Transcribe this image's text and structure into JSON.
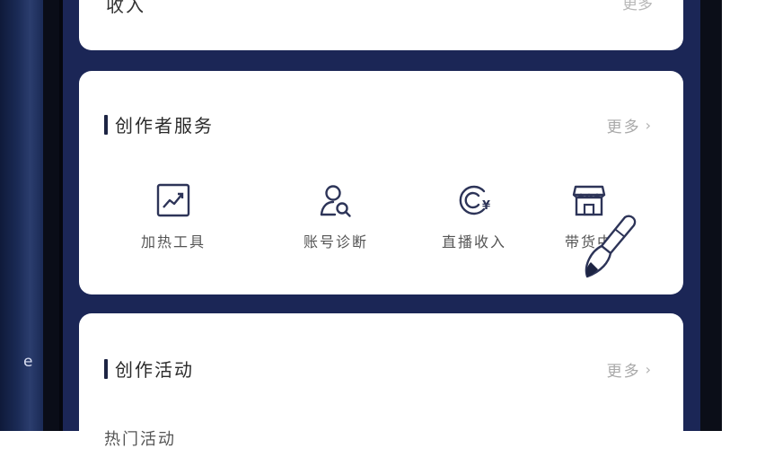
{
  "left_edge": {
    "char": "e"
  },
  "top_card": {
    "title_partial": "收入",
    "more_partial": "更多"
  },
  "creator_services": {
    "title": "创作者服务",
    "more_label": "更多",
    "items": [
      {
        "label": "加热工具",
        "icon": "trending-chart-icon"
      },
      {
        "label": "账号诊断",
        "icon": "user-search-icon"
      },
      {
        "label": "直播收入",
        "icon": "live-revenue-icon"
      },
      {
        "label": "带货中",
        "icon": "store-icon"
      }
    ]
  },
  "creator_activities": {
    "title": "创作活动",
    "more_label": "更多",
    "first_row_partial": "热门活动"
  },
  "colors": {
    "screen_bg": "#1b2656",
    "card_bg": "#ffffff",
    "title_bar": "#1d2443",
    "icon_stroke": "#2d3458",
    "more_text": "#a9a9a9"
  },
  "overlay": {
    "icon": "paint-brush-icon"
  }
}
